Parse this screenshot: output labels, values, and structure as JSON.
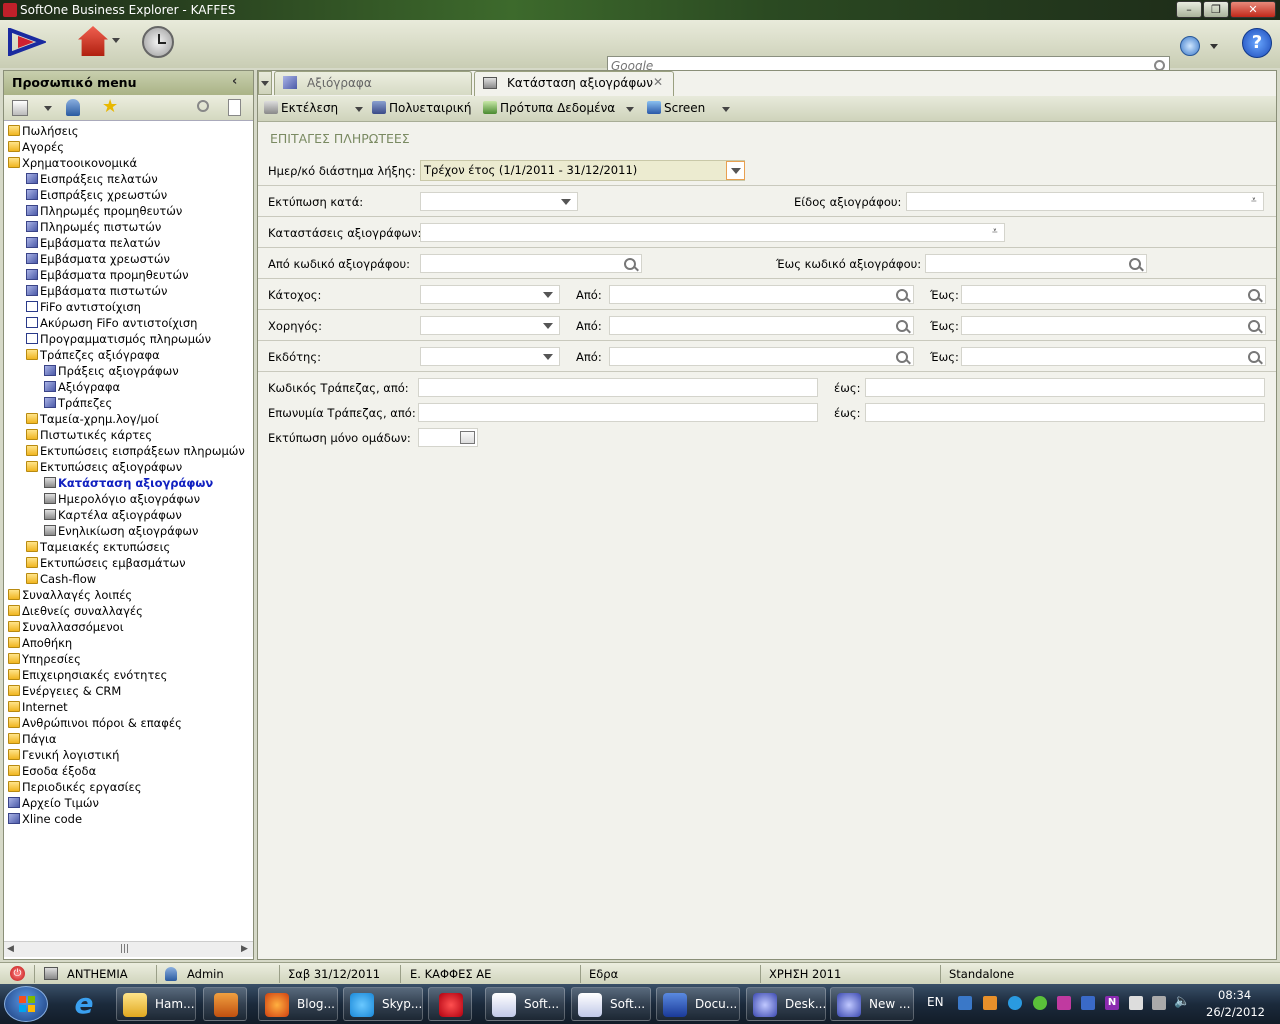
{
  "window": {
    "title": "SoftOne Business Explorer - KAFFES"
  },
  "search": {
    "placeholder": "Google"
  },
  "sidebar": {
    "title": "Προσωπικό menu",
    "tree": [
      {
        "label": "Πωλήσεις",
        "level": 0,
        "icon": "folder-icon"
      },
      {
        "label": "Αγορές",
        "level": 0,
        "icon": "folder-icon"
      },
      {
        "label": "Χρηματοοικονομικά",
        "level": 0,
        "icon": "folder-icon"
      },
      {
        "label": "Εισπράξεις πελατών",
        "level": 1,
        "icon": "cube-icon"
      },
      {
        "label": "Εισπράξεις χρεωστών",
        "level": 1,
        "icon": "cube-icon"
      },
      {
        "label": "Πληρωμές προμηθευτών",
        "level": 1,
        "icon": "cube-icon"
      },
      {
        "label": "Πληρωμές πιστωτών",
        "level": 1,
        "icon": "cube-icon"
      },
      {
        "label": "Εμβάσματα πελατών",
        "level": 1,
        "icon": "cube-icon"
      },
      {
        "label": "Εμβάσματα χρεωστών",
        "level": 1,
        "icon": "cube-icon"
      },
      {
        "label": "Εμβάσματα προμηθευτών",
        "level": 1,
        "icon": "cube-icon"
      },
      {
        "label": "Εμβάσματα πιστωτών",
        "level": 1,
        "icon": "cube-icon"
      },
      {
        "label": "FiFo αντιστοίχιση",
        "level": 1,
        "icon": "chart-icon"
      },
      {
        "label": "Ακύρωση FiFo αντιστοίχιση",
        "level": 1,
        "icon": "chart-icon"
      },
      {
        "label": "Προγραμματισμός πληρωμών",
        "level": 1,
        "icon": "chart-icon"
      },
      {
        "label": "Τράπεζες αξιόγραφα",
        "level": 1,
        "icon": "folder-icon"
      },
      {
        "label": "Πράξεις αξιογράφων",
        "level": 2,
        "icon": "cube-icon"
      },
      {
        "label": "Αξιόγραφα",
        "level": 2,
        "icon": "cube-icon"
      },
      {
        "label": "Τράπεζες",
        "level": 2,
        "icon": "cube-icon"
      },
      {
        "label": "Ταμεία-χρημ.λογ/μοί",
        "level": 1,
        "icon": "folder-icon"
      },
      {
        "label": "Πιστωτικές κάρτες",
        "level": 1,
        "icon": "folder-icon"
      },
      {
        "label": "Εκτυπώσεις εισπράξεων πληρωμών",
        "level": 1,
        "icon": "folder-icon"
      },
      {
        "label": "Εκτυπώσεις αξιογράφων",
        "level": 1,
        "icon": "folder-icon"
      },
      {
        "label": "Κατάσταση αξιογράφων",
        "level": 2,
        "icon": "printer-icon",
        "selected": true
      },
      {
        "label": "Ημερολόγιο αξιογράφων",
        "level": 2,
        "icon": "printer-icon"
      },
      {
        "label": "Καρτέλα αξιογράφων",
        "level": 2,
        "icon": "printer-icon"
      },
      {
        "label": "Ενηλικίωση αξιογράφων",
        "level": 2,
        "icon": "printer-icon"
      },
      {
        "label": "Ταμειακές εκτυπώσεις",
        "level": 1,
        "icon": "folder-icon"
      },
      {
        "label": "Εκτυπώσεις εμβασμάτων",
        "level": 1,
        "icon": "folder-icon"
      },
      {
        "label": "Cash-flow",
        "level": 1,
        "icon": "folder-icon"
      },
      {
        "label": "Συναλλαγές λοιπές",
        "level": 0,
        "icon": "folder-icon"
      },
      {
        "label": "Διεθνείς συναλλαγές",
        "level": 0,
        "icon": "folder-icon"
      },
      {
        "label": "Συναλλασσόμενοι",
        "level": 0,
        "icon": "folder-icon"
      },
      {
        "label": "Αποθήκη",
        "level": 0,
        "icon": "folder-icon"
      },
      {
        "label": "Υπηρεσίες",
        "level": 0,
        "icon": "folder-icon"
      },
      {
        "label": "Επιχειρησιακές ενότητες",
        "level": 0,
        "icon": "folder-icon"
      },
      {
        "label": "Ενέργειες & CRM",
        "level": 0,
        "icon": "folder-icon"
      },
      {
        "label": "Internet",
        "level": 0,
        "icon": "folder-icon"
      },
      {
        "label": "Ανθρώπινοι πόροι & επαφές",
        "level": 0,
        "icon": "folder-icon"
      },
      {
        "label": "Πάγια",
        "level": 0,
        "icon": "folder-icon"
      },
      {
        "label": "Γενική λογιστική",
        "level": 0,
        "icon": "folder-icon"
      },
      {
        "label": "Εσοδα έξοδα",
        "level": 0,
        "icon": "folder-icon"
      },
      {
        "label": "Περιοδικές εργασίες",
        "level": 0,
        "icon": "folder-icon"
      },
      {
        "label": "Αρχείο Τιμών",
        "level": 0,
        "icon": "cube-icon"
      },
      {
        "label": "Xline code",
        "level": 0,
        "icon": "cube-icon"
      }
    ]
  },
  "tabs": [
    {
      "label": "Αξιόγραφα",
      "active": false
    },
    {
      "label": "Κατάσταση αξιογράφων",
      "active": true
    }
  ],
  "toolbar": {
    "run": "Εκτέλεση",
    "multi_company": "Πολυεταιρική",
    "templates": "Πρότυπα Δεδομένα",
    "screen": "Screen"
  },
  "form": {
    "section_title": "ΕΠΙΤΑΓΕΣ ΠΛΗΡΩΤΕΕΣ",
    "period_label": "Ημερ/κό διάστημα λήξης:",
    "period_value": "Τρέχον έτος (1/1/2011 - 31/12/2011)",
    "print_by_label": "Εκτύπωση κατά:",
    "doc_type_label": "Είδος αξιογράφου:",
    "doc_status_label": "Καταστάσεις αξιογράφων:",
    "from_code_label": "Από κωδικό αξιογράφου:",
    "to_code_label": "Έως κωδικό αξιογράφου:",
    "holder_label": "Κάτοχος:",
    "sponsor_label": "Χορηγός:",
    "issuer_label": "Εκδότης:",
    "from_label": "Από:",
    "to_label": "Έως:",
    "bank_code_label": "Κωδικός Τράπεζας, από:",
    "bank_name_label": "Επωνυμία Τράπεζας, από:",
    "until_label": "έως:",
    "groups_only_label": "Εκτύπωση μόνο ομάδων:"
  },
  "status": {
    "db": "ANTHEMIA",
    "user": "Admin",
    "date": "Σαβ 31/12/2011",
    "company": "Ε. ΚΑΦΦΕΣ  ΑΕ",
    "branch": "Εδρα",
    "fiscal": "ΧΡΗΣΗ 2011",
    "mode": "Standalone"
  },
  "taskbar": {
    "items": [
      {
        "label": "Ham...",
        "icon": "folder-icon"
      },
      {
        "label": "",
        "icon": "media-player-icon"
      },
      {
        "label": "Blog...",
        "icon": "firefox-icon"
      },
      {
        "label": "Skyp...",
        "icon": "skype-icon"
      },
      {
        "label": "",
        "icon": "opera-icon"
      },
      {
        "label": "Soft...",
        "icon": "softone-icon"
      },
      {
        "label": "Soft...",
        "icon": "softone-icon"
      },
      {
        "label": "Docu...",
        "icon": "word-icon"
      },
      {
        "label": "Desk...",
        "icon": "remote-desktop-icon"
      },
      {
        "label": "New ...",
        "icon": "remote-desktop-icon"
      }
    ],
    "lang": "EN",
    "time": "08:34",
    "date": "26/2/2012"
  },
  "colors": {
    "accent": "#1020c0",
    "section_title": "#7a8a62",
    "taskbar": "#1b2a3c"
  }
}
